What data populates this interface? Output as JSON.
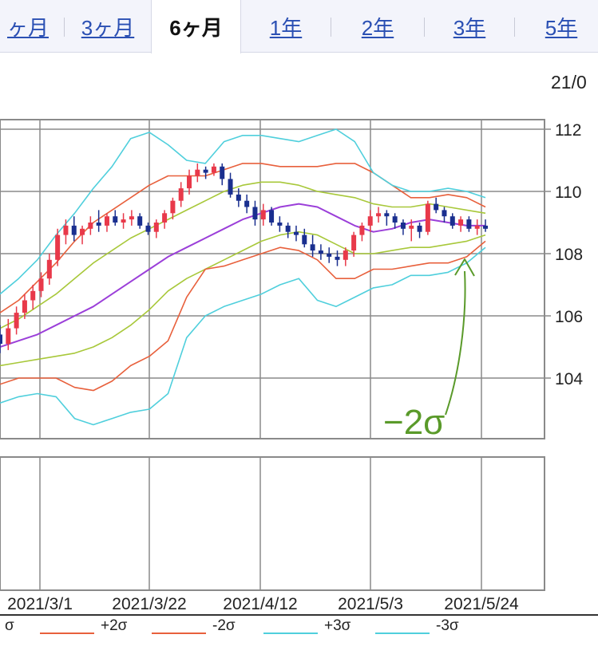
{
  "tabs": [
    {
      "label": "ヶ月",
      "active": false
    },
    {
      "label": "3ヶ月",
      "active": false
    },
    {
      "label": "6ヶ月",
      "active": true
    },
    {
      "label": "1年",
      "active": false
    },
    {
      "label": "2年",
      "active": false
    },
    {
      "label": "3年",
      "active": false
    },
    {
      "label": "5年",
      "active": false
    }
  ],
  "date_fragment": "21/0",
  "annotation": "−2σ",
  "legend": [
    {
      "label": "σ",
      "color": "#9bc43a"
    },
    {
      "label": "+2σ",
      "color": "#e8603c"
    },
    {
      "label": "-2σ",
      "color": "#e8603c"
    },
    {
      "label": "+3σ",
      "color": "#4fcfdc"
    },
    {
      "label": "-3σ",
      "color": "#4fcfdc"
    }
  ],
  "colors": {
    "up": "#e8394a",
    "down": "#1a2f8f",
    "ma": "#9b3fd9",
    "sigma1": "#a8c83a",
    "sigma2": "#e8603c",
    "sigma3": "#4fcfdc",
    "annotation": "#5a9a2a",
    "grid": "#8a8a8a"
  },
  "chart_data": {
    "type": "line",
    "title": "",
    "y_ticks": [
      "112",
      "110",
      "108",
      "106",
      "104"
    ],
    "x_ticks": [
      "2021/3/1",
      "2021/3/22",
      "2021/4/12",
      "2021/5/3",
      "2021/5/24"
    ],
    "ylim": [
      102,
      113
    ],
    "ohlc": [
      [
        105.4,
        105.7,
        104.8,
        105.1
      ],
      [
        105.1,
        105.9,
        104.9,
        105.6
      ],
      [
        105.6,
        106.3,
        105.4,
        106.1
      ],
      [
        106.1,
        106.7,
        105.9,
        106.5
      ],
      [
        106.5,
        107.0,
        106.2,
        106.8
      ],
      [
        106.8,
        107.4,
        106.6,
        107.2
      ],
      [
        107.2,
        108.0,
        107.0,
        107.8
      ],
      [
        107.8,
        108.8,
        107.6,
        108.6
      ],
      [
        108.6,
        109.1,
        108.3,
        108.9
      ],
      [
        108.9,
        109.2,
        108.4,
        108.6
      ],
      [
        108.6,
        108.9,
        108.3,
        108.8
      ],
      [
        108.8,
        109.2,
        108.6,
        109.0
      ],
      [
        109.0,
        109.4,
        108.7,
        108.9
      ],
      [
        108.9,
        109.3,
        108.7,
        109.2
      ],
      [
        109.2,
        109.4,
        108.9,
        109.0
      ],
      [
        109.0,
        109.3,
        108.8,
        109.1
      ],
      [
        109.1,
        109.4,
        108.9,
        109.2
      ],
      [
        109.2,
        109.3,
        108.8,
        108.9
      ],
      [
        108.9,
        109.0,
        108.6,
        108.7
      ],
      [
        108.7,
        109.1,
        108.5,
        109.0
      ],
      [
        109.0,
        109.4,
        108.8,
        109.3
      ],
      [
        109.3,
        109.8,
        109.1,
        109.7
      ],
      [
        109.7,
        110.3,
        109.5,
        110.1
      ],
      [
        110.1,
        110.7,
        109.9,
        110.5
      ],
      [
        110.5,
        110.9,
        110.3,
        110.7
      ],
      [
        110.7,
        110.8,
        110.4,
        110.6
      ],
      [
        110.6,
        110.9,
        110.5,
        110.8
      ],
      [
        110.8,
        110.9,
        110.2,
        110.4
      ],
      [
        110.4,
        110.6,
        109.8,
        109.9
      ],
      [
        109.9,
        110.1,
        109.5,
        109.7
      ],
      [
        109.7,
        109.9,
        109.3,
        109.5
      ],
      [
        109.5,
        109.7,
        108.9,
        109.1
      ],
      [
        109.1,
        109.6,
        108.9,
        109.4
      ],
      [
        109.4,
        109.5,
        108.9,
        109.0
      ],
      [
        109.0,
        109.2,
        108.7,
        108.9
      ],
      [
        108.9,
        109.0,
        108.5,
        108.7
      ],
      [
        108.7,
        108.9,
        108.4,
        108.6
      ],
      [
        108.6,
        108.8,
        108.2,
        108.3
      ],
      [
        108.3,
        108.6,
        107.9,
        108.1
      ],
      [
        108.1,
        108.3,
        107.8,
        108.0
      ],
      [
        108.0,
        108.2,
        107.7,
        107.9
      ],
      [
        107.9,
        108.1,
        107.6,
        107.8
      ],
      [
        107.8,
        108.2,
        107.6,
        108.1
      ],
      [
        108.1,
        108.7,
        107.9,
        108.6
      ],
      [
        108.6,
        109.0,
        108.4,
        108.9
      ],
      [
        108.9,
        109.4,
        108.7,
        109.2
      ],
      [
        109.2,
        109.5,
        109.0,
        109.3
      ],
      [
        109.3,
        109.4,
        108.9,
        109.2
      ],
      [
        109.2,
        109.3,
        108.8,
        109.0
      ],
      [
        109.0,
        109.1,
        108.6,
        108.8
      ],
      [
        108.8,
        109.1,
        108.4,
        108.9
      ],
      [
        108.9,
        109.0,
        108.5,
        108.7
      ],
      [
        108.7,
        109.7,
        108.6,
        109.6
      ],
      [
        109.6,
        109.8,
        109.3,
        109.4
      ],
      [
        109.4,
        109.5,
        109.0,
        109.2
      ],
      [
        109.2,
        109.3,
        108.8,
        108.9
      ],
      [
        108.9,
        109.2,
        108.7,
        109.1
      ],
      [
        109.1,
        109.2,
        108.7,
        108.8
      ],
      [
        108.8,
        109.1,
        108.6,
        108.9
      ],
      [
        108.9,
        109.1,
        108.7,
        108.8
      ]
    ],
    "series": [
      {
        "key": "ma",
        "values": [
          105.0,
          105.2,
          105.4,
          105.7,
          106.0,
          106.3,
          106.7,
          107.1,
          107.5,
          107.9,
          108.2,
          108.5,
          108.8,
          109.1,
          109.3,
          109.5,
          109.6,
          109.5,
          109.2,
          108.9,
          108.7,
          108.8,
          109.0,
          109.1,
          109.0,
          108.9,
          108.9
        ]
      },
      {
        "key": "s1u",
        "values": [
          105.6,
          105.9,
          106.3,
          106.7,
          107.2,
          107.7,
          108.1,
          108.5,
          108.8,
          109.1,
          109.4,
          109.7,
          110.0,
          110.2,
          110.3,
          110.3,
          110.2,
          110.0,
          109.9,
          109.8,
          109.6,
          109.5,
          109.5,
          109.6,
          109.5,
          109.4,
          109.3
        ]
      },
      {
        "key": "s1l",
        "values": [
          104.4,
          104.5,
          104.6,
          104.7,
          104.8,
          105.0,
          105.3,
          105.7,
          106.2,
          106.8,
          107.2,
          107.5,
          107.8,
          108.1,
          108.4,
          108.6,
          108.7,
          108.6,
          108.3,
          108.0,
          108.0,
          108.1,
          108.2,
          108.2,
          108.3,
          108.4,
          108.6
        ]
      },
      {
        "key": "s2u",
        "values": [
          106.1,
          106.5,
          107.1,
          107.7,
          108.4,
          109.0,
          109.4,
          109.8,
          110.2,
          110.5,
          110.5,
          110.5,
          110.7,
          110.9,
          110.9,
          110.8,
          110.8,
          110.8,
          110.9,
          110.9,
          110.6,
          110.2,
          109.8,
          109.8,
          109.9,
          109.8,
          109.5
        ]
      },
      {
        "key": "s2l",
        "values": [
          103.8,
          104.0,
          104.0,
          104.0,
          103.7,
          103.6,
          103.9,
          104.4,
          104.7,
          105.2,
          106.6,
          107.5,
          107.6,
          107.8,
          108.0,
          108.2,
          108.1,
          107.8,
          107.2,
          107.2,
          107.5,
          107.5,
          107.6,
          107.7,
          107.7,
          107.9,
          108.4
        ]
      },
      {
        "key": "s3u",
        "values": [
          106.7,
          107.2,
          107.8,
          108.6,
          109.3,
          110.1,
          110.8,
          111.7,
          111.9,
          111.5,
          111.0,
          110.9,
          111.6,
          111.8,
          111.8,
          111.7,
          111.6,
          111.8,
          112.0,
          111.6,
          110.6,
          110.2,
          110.0,
          110.0,
          110.1,
          110.0,
          109.8
        ]
      },
      {
        "key": "s3l",
        "values": [
          103.2,
          103.4,
          103.5,
          103.4,
          102.7,
          102.5,
          102.7,
          102.9,
          103.0,
          103.5,
          105.3,
          106.0,
          106.3,
          106.5,
          106.7,
          107.0,
          107.2,
          106.5,
          106.3,
          106.6,
          106.9,
          107.0,
          107.3,
          107.3,
          107.4,
          107.7,
          108.2
        ]
      }
    ]
  }
}
